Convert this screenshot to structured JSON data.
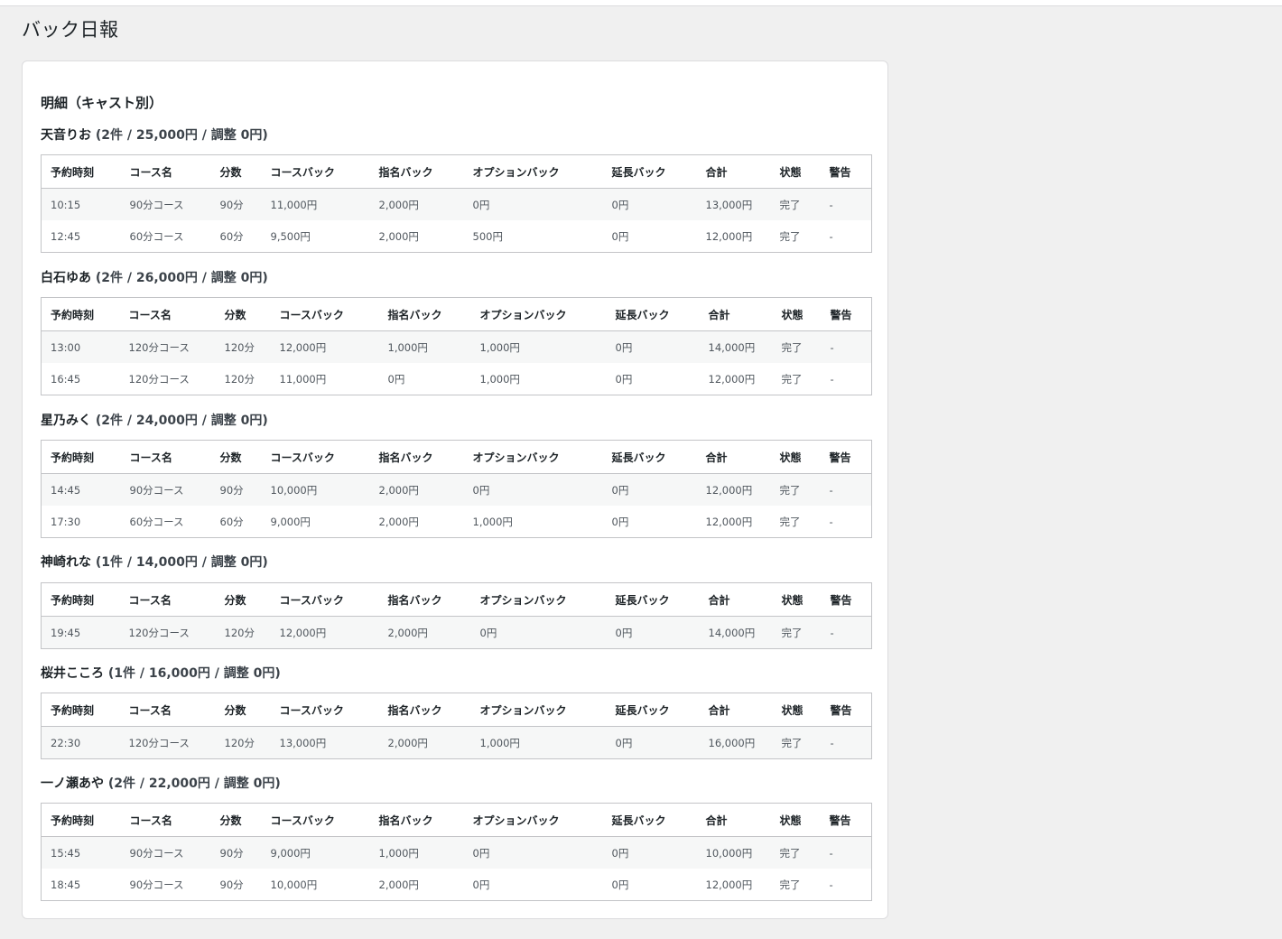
{
  "page": {
    "title": "バック日報"
  },
  "section": {
    "title": "明細（キャスト別）"
  },
  "columns": [
    "予約時刻",
    "コース名",
    "分数",
    "コースバック",
    "指名バック",
    "オプションバック",
    "延長バック",
    "合計",
    "状態",
    "警告"
  ],
  "casts": [
    {
      "name": "天音りお",
      "summary": "(2件 / 25,000円 / 調整 0円)",
      "rows": [
        [
          "10:15",
          "90分コース",
          "90分",
          "11,000円",
          "2,000円",
          "0円",
          "0円",
          "13,000円",
          "完了",
          "-"
        ],
        [
          "12:45",
          "60分コース",
          "60分",
          "9,500円",
          "2,000円",
          "500円",
          "0円",
          "12,000円",
          "完了",
          "-"
        ]
      ]
    },
    {
      "name": "白石ゆあ",
      "summary": "(2件 / 26,000円 / 調整 0円)",
      "rows": [
        [
          "13:00",
          "120分コース",
          "120分",
          "12,000円",
          "1,000円",
          "1,000円",
          "0円",
          "14,000円",
          "完了",
          "-"
        ],
        [
          "16:45",
          "120分コース",
          "120分",
          "11,000円",
          "0円",
          "1,000円",
          "0円",
          "12,000円",
          "完了",
          "-"
        ]
      ]
    },
    {
      "name": "星乃みく",
      "summary": "(2件 / 24,000円 / 調整 0円)",
      "rows": [
        [
          "14:45",
          "90分コース",
          "90分",
          "10,000円",
          "2,000円",
          "0円",
          "0円",
          "12,000円",
          "完了",
          "-"
        ],
        [
          "17:30",
          "60分コース",
          "60分",
          "9,000円",
          "2,000円",
          "1,000円",
          "0円",
          "12,000円",
          "完了",
          "-"
        ]
      ]
    },
    {
      "name": "神崎れな",
      "summary": "(1件 / 14,000円 / 調整 0円)",
      "rows": [
        [
          "19:45",
          "120分コース",
          "120分",
          "12,000円",
          "2,000円",
          "0円",
          "0円",
          "14,000円",
          "完了",
          "-"
        ]
      ]
    },
    {
      "name": "桜井こころ",
      "summary": "(1件 / 16,000円 / 調整 0円)",
      "rows": [
        [
          "22:30",
          "120分コース",
          "120分",
          "13,000円",
          "2,000円",
          "1,000円",
          "0円",
          "16,000円",
          "完了",
          "-"
        ]
      ]
    },
    {
      "name": "一ノ瀬あや",
      "summary": "(2件 / 22,000円 / 調整 0円)",
      "rows": [
        [
          "15:45",
          "90分コース",
          "90分",
          "9,000円",
          "1,000円",
          "0円",
          "0円",
          "10,000円",
          "完了",
          "-"
        ],
        [
          "18:45",
          "90分コース",
          "90分",
          "10,000円",
          "2,000円",
          "0円",
          "0円",
          "12,000円",
          "完了",
          "-"
        ]
      ]
    }
  ]
}
